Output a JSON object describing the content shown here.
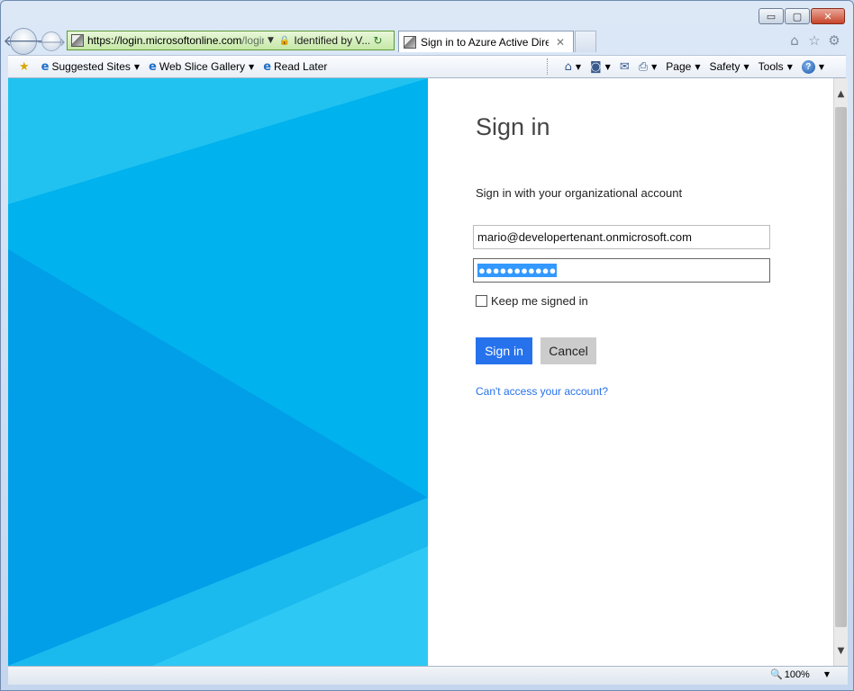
{
  "window": {
    "minimize": "▭",
    "maximize": "▢",
    "close": "✕"
  },
  "nav": {
    "back_icon": "🡐",
    "forward_icon": "🡒",
    "address": {
      "url_host": "https://login.microsoftonline.com",
      "url_rest": "/login.",
      "identity": "Identified by V..."
    },
    "tab": {
      "title": "Sign in to Azure Active Dire..."
    },
    "right_icons": [
      "home-icon",
      "favorites-star-icon",
      "settings-gear-icon"
    ]
  },
  "favbar": {
    "items": [
      {
        "label": "Suggested Sites"
      },
      {
        "label": "Web Slice Gallery"
      },
      {
        "label": "Read Later"
      }
    ]
  },
  "commandbar": {
    "page": "Page",
    "safety": "Safety",
    "tools": "Tools"
  },
  "signin": {
    "title": "Sign in",
    "subtitle": "Sign in with your organizational account",
    "email_value": "mario@developertenant.onmicrosoft.com",
    "password_mask": "●●●●●●●●●●●",
    "keep_signed_in": "Keep me signed in",
    "signin_button": "Sign in",
    "cancel_button": "Cancel",
    "cant_access": "Can't access your account?"
  },
  "colors": {
    "accent": "#2672ec",
    "hero_light": "#21c2f0",
    "hero_mid": "#00b2ee",
    "hero_dark": "#009fe8"
  },
  "statusbar": {
    "zoom": "100%"
  }
}
